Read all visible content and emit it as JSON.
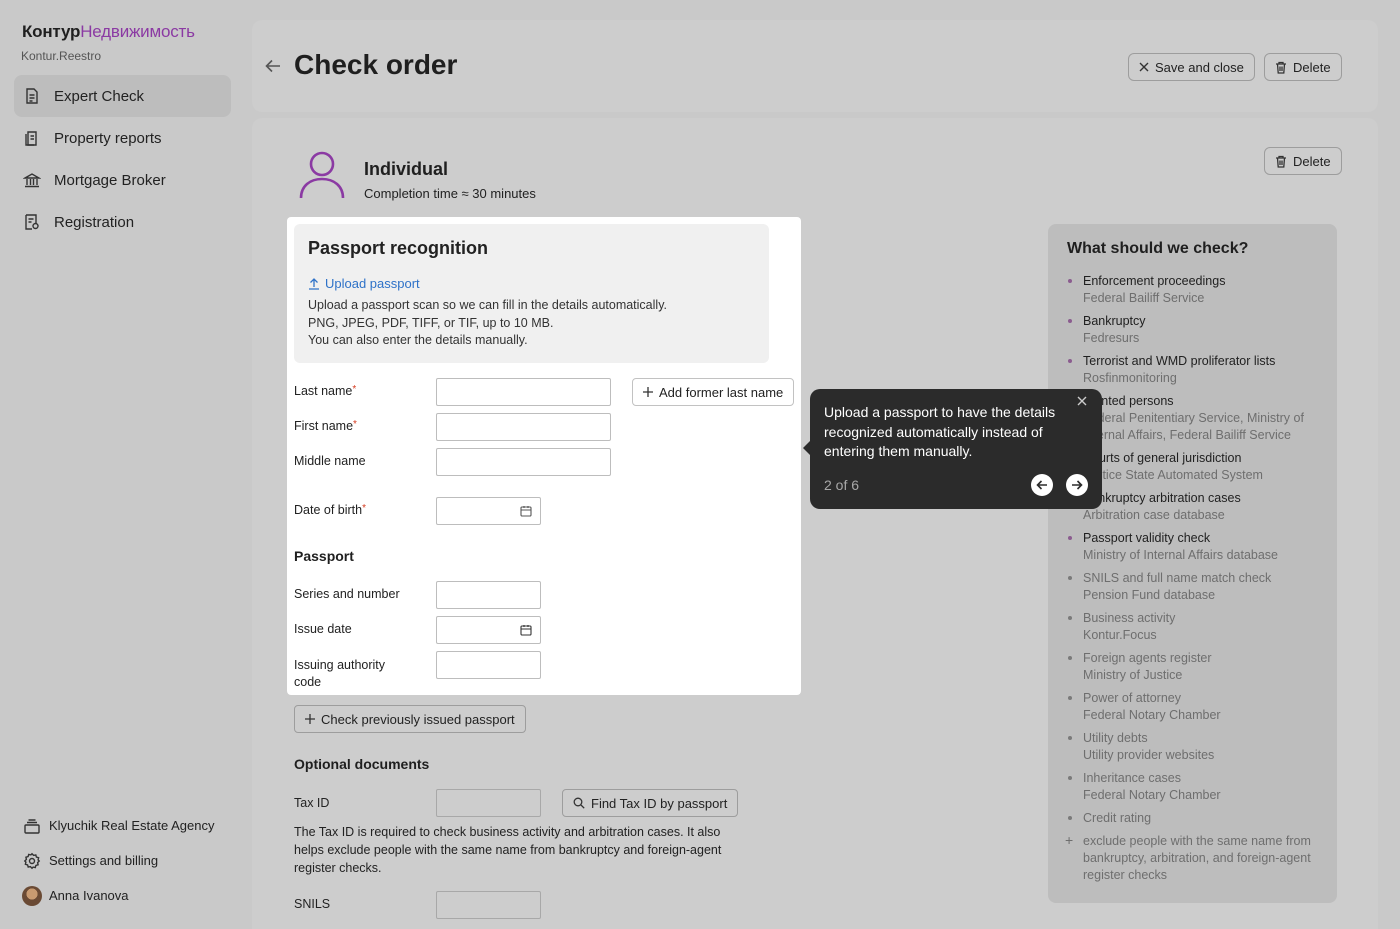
{
  "brand": {
    "name": "Контур",
    "product": "Недвижимость",
    "sub": "Kontur.Reestro"
  },
  "sidebar": {
    "items": [
      {
        "label": "Expert Check",
        "icon": "document-icon",
        "active": true
      },
      {
        "label": "Property reports",
        "icon": "reports-icon"
      },
      {
        "label": "Mortgage Broker",
        "icon": "bank-icon"
      },
      {
        "label": "Registration",
        "icon": "registration-icon"
      }
    ],
    "bottom": [
      {
        "label": "Klyuchik Real Estate Agency",
        "icon": "organization-icon"
      },
      {
        "label": "Settings and billing",
        "icon": "gear-icon"
      },
      {
        "label": "Anna Ivanova",
        "icon": "avatar"
      }
    ]
  },
  "header": {
    "title": "Check order",
    "save_close": "Save and close",
    "delete": "Delete"
  },
  "individual": {
    "title": "Individual",
    "subtitle": "Completion time ≈ 30 minutes",
    "delete": "Delete"
  },
  "recognition": {
    "title": "Passport recognition",
    "upload_link": "Upload passport",
    "lines": [
      "Upload a passport scan so we can fill in the details automatically.",
      "PNG, JPEG, PDF, TIFF, or TIF, up to 10 MB.",
      "You can also enter the details manually."
    ]
  },
  "form": {
    "last_name": "Last name",
    "first_name": "First name",
    "middle_name": "Middle name",
    "date_of_birth": "Date of birth",
    "add_former": "Add former last name",
    "passport_heading": "Passport",
    "series_number": "Series and number",
    "issue_date": "Issue date",
    "issuing_code_1": "Issuing authority",
    "issuing_code_2": "code",
    "check_prev": "Check previously issued passport",
    "optional_heading": "Optional documents",
    "tax_id": "Tax ID",
    "find_tax": "Find Tax ID by passport",
    "tax_note": "The Tax ID is required to check business activity and arbitration cases. It also helps exclude people with the same name from bankruptcy and foreign-agent register checks.",
    "snils": "SNILS"
  },
  "tooltip": {
    "text": "Upload a passport to have the details recognized automatically instead of entering them manually.",
    "step": "2 of 6"
  },
  "checks": {
    "title": "What should we check?",
    "items": [
      {
        "name": "Enforcement proceedings",
        "source": "Federal Bailiff Service"
      },
      {
        "name": "Bankruptcy",
        "source": "Fedresurs"
      },
      {
        "name": "Terrorist and WMD proliferator lists",
        "source": "Rosfinmonitoring"
      },
      {
        "name": "Wanted persons",
        "source": "Federal Penitentiary Service, Ministry of Internal Affairs, Federal Bailiff Service"
      },
      {
        "name": "Courts of general jurisdiction",
        "source": "Justice State Automated System"
      },
      {
        "name": "Bankruptcy arbitration cases",
        "source": "Arbitration case database"
      },
      {
        "name": "Passport validity check",
        "source": "Ministry of Internal Affairs database"
      },
      {
        "name": "SNILS and full name match check",
        "source": "Pension Fund database"
      },
      {
        "name": "Business activity",
        "source": "Kontur.Focus"
      },
      {
        "name": "Foreign agents register",
        "source": "Ministry of Justice"
      },
      {
        "name": "Power of attorney",
        "source": "Federal Notary Chamber"
      },
      {
        "name": "Utility debts",
        "source": "Utility provider websites"
      },
      {
        "name": "Inheritance cases",
        "source": "Federal Notary Chamber"
      },
      {
        "name": "Credit rating",
        "source": ""
      }
    ],
    "extra": "exclude people with the same name from bankruptcy, arbitration, and foreign-agent register checks"
  },
  "colors": {
    "accent": "#8b3aa3",
    "link": "#2e72c8",
    "required": "#d63b1f",
    "tooltip_bg": "#2b2b2b"
  }
}
